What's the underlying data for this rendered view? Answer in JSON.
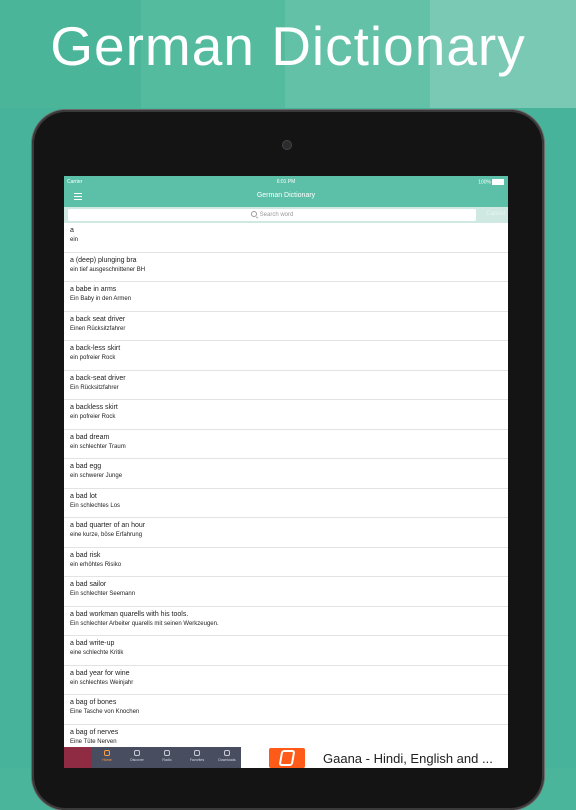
{
  "banner": {
    "title": "German Dictionary"
  },
  "status": {
    "carrier": "Carrier",
    "time": "6:01 PM",
    "battery": "100%"
  },
  "navbar": {
    "title": "German Dictionary"
  },
  "search": {
    "placeholder": "Search word",
    "cancel_label": "Cancel"
  },
  "entries": [
    {
      "word": "a",
      "translation": "ein"
    },
    {
      "word": "a (deep) plunging bra",
      "translation": "ein tief ausgeschnittener BH"
    },
    {
      "word": "a babe in arms",
      "translation": "Ein Baby in den Armen"
    },
    {
      "word": "a back seat driver",
      "translation": "Einen Rücksitzfahrer"
    },
    {
      "word": "a back-less skirt",
      "translation": "ein pofreier Rock"
    },
    {
      "word": "a back-seat driver",
      "translation": "Ein Rücksitzfahrer"
    },
    {
      "word": "a backless skirt",
      "translation": "ein pofreier Rock"
    },
    {
      "word": "a bad dream",
      "translation": "ein schlechter Traum"
    },
    {
      "word": "a bad egg",
      "translation": "ein schwerer Junge"
    },
    {
      "word": "a bad lot",
      "translation": "Ein schlechtes Los"
    },
    {
      "word": "a bad quarter of an hour",
      "translation": "eine kurze, böse Erfahrung"
    },
    {
      "word": "a bad risk",
      "translation": "ein erhöhtes Risiko"
    },
    {
      "word": "a bad sailor",
      "translation": "Ein schlechter Seemann"
    },
    {
      "word": "a bad workman quarells with his tools.",
      "translation": "Ein schlechter Arbeiter quarells mit seinen Werkzeugen."
    },
    {
      "word": "a bad write-up",
      "translation": "eine schlechte Kritik"
    },
    {
      "word": "a bad year for wine",
      "translation": "ein schlechtes Weinjahr"
    },
    {
      "word": "a bag of bones",
      "translation": "Eine Tasche von Knochen"
    },
    {
      "word": "a bag of nerves",
      "translation": "Eine Tüte Nerven"
    }
  ],
  "ad": {
    "text": "Gaana - Hindi, English and ...",
    "tabs": [
      "Home",
      "Discover",
      "Radio",
      "Favorites",
      "Downloads"
    ]
  }
}
